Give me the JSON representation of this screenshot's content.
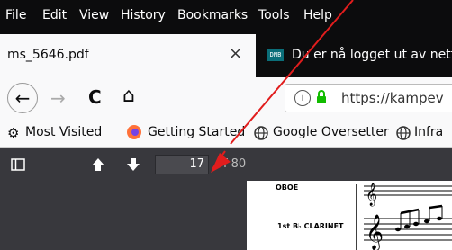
{
  "menu": {
    "items": [
      {
        "label": "File",
        "x": 0
      },
      {
        "label": "Edit",
        "x": 0
      },
      {
        "label": "View",
        "x": 0
      },
      {
        "label": "History",
        "x": 0
      },
      {
        "label": "Bookmarks",
        "x": 0
      },
      {
        "label": "Tools",
        "x": 0
      },
      {
        "label": "Help",
        "x": 0
      }
    ]
  },
  "tabs": {
    "active": {
      "title": "ms_5646.pdf",
      "close": "×"
    },
    "second": {
      "favicon": "DNB",
      "title": "Du er nå logget ut av nettb"
    }
  },
  "navbar": {
    "back": "←",
    "forward": "→",
    "reload": "C",
    "home": "⌂",
    "url": "https://kampev"
  },
  "bookmarks": {
    "items": [
      "Most Visited",
      "Getting Started",
      "Google Oversetter",
      "Infra"
    ]
  },
  "pdf": {
    "page_current": "17",
    "page_total": "of 80"
  },
  "score": {
    "labels": [
      "OBOE",
      "1st B♭ CLARINET"
    ]
  },
  "colors": {
    "annotation": "#e11d1d",
    "accent": "#0a84ff"
  }
}
